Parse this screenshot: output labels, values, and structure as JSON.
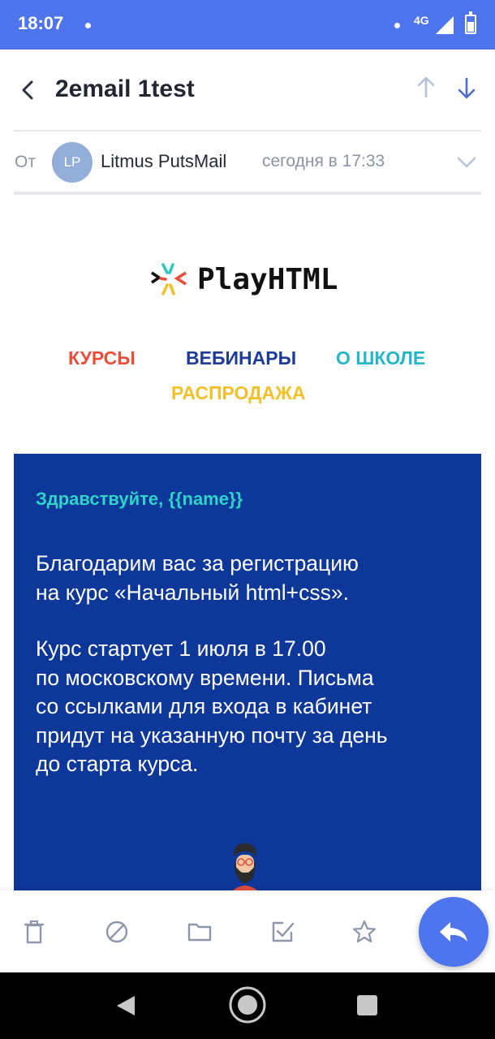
{
  "status_bar": {
    "time": "18:07",
    "network": "4G"
  },
  "header": {
    "subject": "2email 1test"
  },
  "from_row": {
    "label": "От",
    "avatar_initials": "LP",
    "sender": "Litmus PutsMail",
    "date": "сегодня в 17:33"
  },
  "email": {
    "logo_text": "PlayHTML",
    "menu": [
      "КУРСЫ",
      "ВЕБИНАРЫ",
      "О ШКОЛЕ",
      "РАСПРОДАЖА"
    ],
    "greeting": "Здравствуйте, {{name}}",
    "paragraph1": "Благодарим вас за регистрацию\nна курс «Начальный html+css».",
    "paragraph2": "Курс стартует 1 июля в 17.00\nпо московскому времени. Письма\nсо ссылками для входа в кабинет\nпридут на указанную почту за день\nдо старта курса."
  },
  "colors": {
    "accent": "#4e74ee",
    "email_block": "#0e379a",
    "greeting": "#2fd4c8",
    "menu_kursy": "#e94e3b",
    "menu_vebinary": "#1d3b9a",
    "menu_o_shkole": "#26b6c8",
    "menu_rasprodazha": "#f4c02a"
  },
  "icons": {
    "header": [
      "back-arrow-icon",
      "arrow-up-icon",
      "arrow-down-icon",
      "chevron-down-icon"
    ],
    "actions": [
      "trash-icon",
      "block-icon",
      "folder-icon",
      "mark-done-icon",
      "star-icon",
      "reply-icon"
    ],
    "system_nav": [
      "back-triangle-icon",
      "home-circle-icon",
      "recents-square-icon"
    ]
  }
}
